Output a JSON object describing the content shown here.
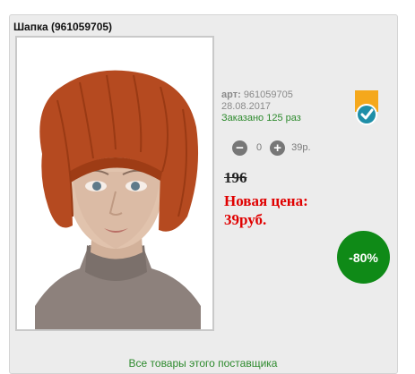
{
  "product": {
    "title": "Шапка (961059705)",
    "article_label": "арт:",
    "article": "961059705",
    "date": "28.08.2017",
    "ordered": "Заказано 125 раз",
    "quantity": "0",
    "unit_price": "39р.",
    "old_price": "196",
    "new_price": "Новая цена: 39руб.",
    "discount": "-80%",
    "supplier_link": "Все товары этого поставщика"
  },
  "colors": {
    "accent_green": "#0f8a17",
    "price_red": "#e00000",
    "badge_orange": "#f5a81c",
    "badge_check": "#1f8fa8"
  },
  "icons": {
    "minus": "minus-icon",
    "plus": "plus-icon",
    "badge": "verified-badge-icon"
  }
}
